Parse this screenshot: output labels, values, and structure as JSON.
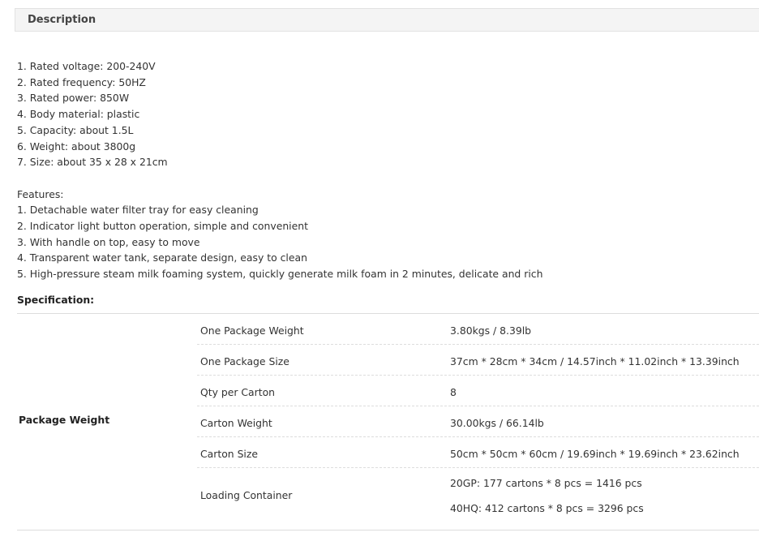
{
  "header": {
    "title": "Description"
  },
  "description": {
    "specs": [
      "1. Rated voltage: 200-240V",
      "2. Rated frequency: 50HZ",
      "3. Rated power: 850W",
      "4. Body material: plastic",
      "5. Capacity: about 1.5L",
      "6. Weight: about 3800g",
      "7. Size: about 35 x 28 x 21cm"
    ],
    "features_heading": "Features:",
    "features": [
      "1. Detachable water filter tray for easy cleaning",
      "2. Indicator light button operation, simple and convenient",
      "3. With handle on top, easy to move",
      "4. Transparent water tank, separate design, easy to clean",
      "5. High-pressure steam milk foaming system, quickly generate milk foam in 2 minutes, delicate and rich"
    ]
  },
  "specification": {
    "title": "Specification:",
    "group_label": "Package Weight",
    "rows": [
      {
        "key": "One Package Weight",
        "value": "3.80kgs / 8.39lb"
      },
      {
        "key": "One Package Size",
        "value": "37cm * 28cm * 34cm / 14.57inch * 11.02inch * 13.39inch"
      },
      {
        "key": "Qty per Carton",
        "value": "8"
      },
      {
        "key": "Carton Weight",
        "value": "30.00kgs / 66.14lb"
      },
      {
        "key": "Carton Size",
        "value": "50cm * 50cm * 60cm / 19.69inch * 19.69inch * 23.62inch"
      }
    ],
    "loading": {
      "key": "Loading Container",
      "values": [
        "20GP: 177 cartons * 8 pcs = 1416 pcs",
        "40HQ: 412 cartons * 8 pcs = 3296 pcs"
      ]
    }
  }
}
